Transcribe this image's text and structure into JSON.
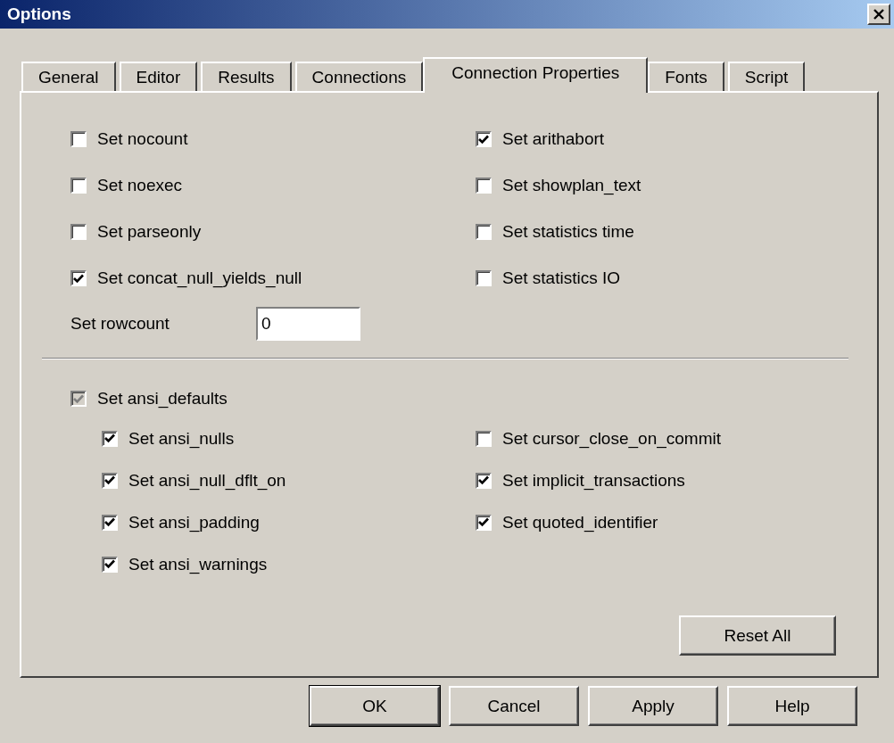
{
  "window": {
    "title": "Options"
  },
  "tabs": [
    {
      "label": "General",
      "selected": false
    },
    {
      "label": "Editor",
      "selected": false
    },
    {
      "label": "Results",
      "selected": false
    },
    {
      "label": "Connections",
      "selected": false
    },
    {
      "label": "Connection Properties",
      "selected": true
    },
    {
      "label": "Fonts",
      "selected": false
    },
    {
      "label": "Script",
      "selected": false
    }
  ],
  "options_left": [
    {
      "label": "Set nocount",
      "checked": false
    },
    {
      "label": "Set noexec",
      "checked": false
    },
    {
      "label": "Set parseonly",
      "checked": false
    },
    {
      "label": "Set concat_null_yields_null",
      "checked": true
    }
  ],
  "options_right": [
    {
      "label": "Set arithabort",
      "checked": true
    },
    {
      "label": "Set showplan_text",
      "checked": false
    },
    {
      "label": "Set statistics time",
      "checked": false
    },
    {
      "label": "Set statistics IO",
      "checked": false
    }
  ],
  "rowcount": {
    "label": "Set rowcount",
    "value": "0"
  },
  "ansi_defaults": {
    "label": "Set ansi_defaults",
    "checked": true,
    "disabled": true
  },
  "ansi_left": [
    {
      "label": "Set ansi_nulls",
      "checked": true
    },
    {
      "label": "Set ansi_null_dflt_on",
      "checked": true
    },
    {
      "label": "Set ansi_padding",
      "checked": true
    },
    {
      "label": "Set ansi_warnings",
      "checked": true
    }
  ],
  "ansi_right": [
    {
      "label": "Set cursor_close_on_commit",
      "checked": false
    },
    {
      "label": "Set implicit_transactions",
      "checked": true
    },
    {
      "label": "Set quoted_identifier",
      "checked": true
    }
  ],
  "reset_button": "Reset All",
  "buttons": [
    "OK",
    "Cancel",
    "Apply",
    "Help"
  ]
}
